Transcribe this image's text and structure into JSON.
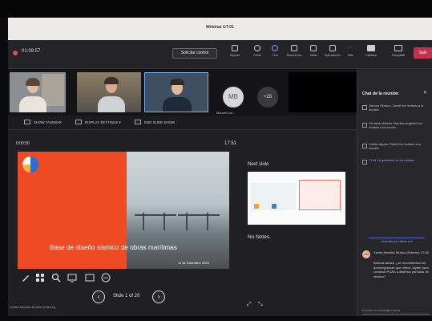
{
  "window": {
    "title": "Webinar GT-01"
  },
  "toolbar": {
    "timer": "01:09:57",
    "stop_label": "Solicitar control",
    "items": [
      {
        "label": "Soporte",
        "icon": "rectangle-icon"
      },
      {
        "label": "Gente",
        "icon": "people-icon"
      },
      {
        "label": "Chat",
        "icon": "chat-icon"
      },
      {
        "label": "Reacciones",
        "icon": "emoji-icon"
      },
      {
        "label": "Salas",
        "icon": "rooms-icon"
      },
      {
        "label": "Aplicaciones",
        "icon": "apps-icon"
      },
      {
        "label": "Más",
        "icon": "more-icon"
      }
    ],
    "camera_label": "Cámara",
    "share_label": "Compartir",
    "leave_label": "Salir"
  },
  "participants": {
    "avatar_initials": "MB",
    "avatar_name": "Manuel Ara...",
    "more_count": "+26"
  },
  "presenter_bar": {
    "taskbar": "SHOW TASKBAR",
    "display": "DISPLAY SETTINGS ▾",
    "end": "END SLIDE SHOW"
  },
  "presenter": {
    "elapsed": "0:00:30",
    "clock": "17:51",
    "slide_caption": "Base de diseño sísmico de obras marítimas",
    "slide_date": "11 de Diciembre 2020",
    "slide_counter": "Slide 1 of 20",
    "next_slide_label": "Next slide",
    "notes": "No Notes."
  },
  "status_line": "Xavier Amañez Muñoz (externo)",
  "chat": {
    "title": "Chat de la reunión",
    "system_messages": [
      "Zamora Serrano, Daniel fue invitado a la reunión.",
      "Fernando Alberto Sánchez Anglesio fue invitado a la reunión.",
      "Cobián Agudo, Rubén fue invitado a la reunión.",
      "17:44 La grabación se ha iniciado"
    ],
    "unread_label": "Lecturas por última vez",
    "message": {
      "initials": "XM",
      "author": "Xavier Amañez Muñoz (Externo)",
      "time": "17:48",
      "text": "Buenas tardes, ¿se recomiendan los acelerogramas que ofrece Jupiter para construir PGA's a distintos periodos de retorno?"
    },
    "input_placeholder": "Escribe un mensaje nuevo"
  }
}
